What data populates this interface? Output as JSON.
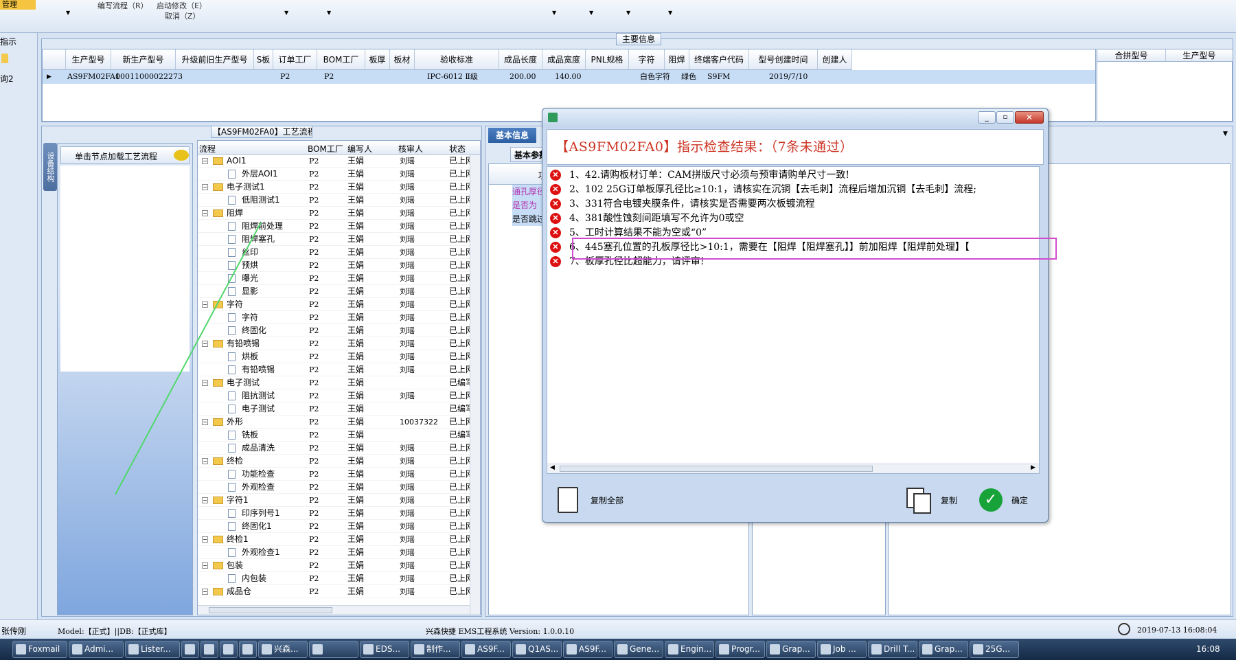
{
  "toolbar": {
    "items": [
      "编写流程（R）",
      "启动修改（E）",
      "取消（Z）"
    ],
    "left_title": "管理"
  },
  "leftnav": {
    "items": [
      "指示",
      "询2"
    ]
  },
  "main_info": {
    "title": "主要信息",
    "columns": [
      "生产型号",
      "新生产型号",
      "升级前旧生产型号",
      "S板",
      "订单工厂",
      "BOM工厂",
      "板厚",
      "板材",
      "验收标准",
      "成品长度",
      "成品宽度",
      "PNL规格",
      "字符",
      "阻焊",
      "终端客户代码",
      "型号创建时间",
      "创建人"
    ],
    "row": [
      "AS9FM02FA0",
      "10011000022273",
      "",
      "",
      "P2",
      "P2",
      "",
      "",
      "IPC-6012 Ⅱ级",
      "200.00",
      "140.00",
      "",
      "白色字符",
      "绿色",
      "S9FM",
      "2019/7/10",
      ""
    ],
    "side_columns": [
      "合拼型号",
      "生产型号"
    ]
  },
  "process": {
    "title": "【AS9FM02FA0】工艺流程",
    "side_tab": "设备结构",
    "hint": "单击节点加载工艺流程",
    "columns": [
      "流程",
      "BOM工厂",
      "编写人",
      "核审人",
      "状态"
    ],
    "rows": [
      {
        "name": "AOI1",
        "level": 1,
        "bom": "P2",
        "writer": "王娟",
        "reviewer": "刘瑶",
        "status": "已上网"
      },
      {
        "name": "外层AOI1",
        "level": 2,
        "bom": "P2",
        "writer": "王娟",
        "reviewer": "刘瑶",
        "status": "已上网"
      },
      {
        "name": "电子测试1",
        "level": 1,
        "bom": "P2",
        "writer": "王娟",
        "reviewer": "刘瑶",
        "status": "已上网"
      },
      {
        "name": "低阻测试1",
        "level": 2,
        "bom": "P2",
        "writer": "王娟",
        "reviewer": "刘瑶",
        "status": "已上网"
      },
      {
        "name": "阻焊",
        "level": 1,
        "bom": "P2",
        "writer": "王娟",
        "reviewer": "刘瑶",
        "status": "已上网"
      },
      {
        "name": "阻焊前处理",
        "level": 2,
        "bom": "P2",
        "writer": "王娟",
        "reviewer": "刘瑶",
        "status": "已上网"
      },
      {
        "name": "阻焊塞孔",
        "level": 2,
        "bom": "P2",
        "writer": "王娟",
        "reviewer": "刘瑶",
        "status": "已上网"
      },
      {
        "name": "丝印",
        "level": 2,
        "bom": "P2",
        "writer": "王娟",
        "reviewer": "刘瑶",
        "status": "已上网"
      },
      {
        "name": "预烘",
        "level": 2,
        "bom": "P2",
        "writer": "王娟",
        "reviewer": "刘瑶",
        "status": "已上网"
      },
      {
        "name": "曝光",
        "level": 2,
        "bom": "P2",
        "writer": "王娟",
        "reviewer": "刘瑶",
        "status": "已上网"
      },
      {
        "name": "显影",
        "level": 2,
        "bom": "P2",
        "writer": "王娟",
        "reviewer": "刘瑶",
        "status": "已上网"
      },
      {
        "name": "字符",
        "level": 1,
        "bom": "P2",
        "writer": "王娟",
        "reviewer": "刘瑶",
        "status": "已上网"
      },
      {
        "name": "字符",
        "level": 2,
        "bom": "P2",
        "writer": "王娟",
        "reviewer": "刘瑶",
        "status": "已上网"
      },
      {
        "name": "终固化",
        "level": 2,
        "bom": "P2",
        "writer": "王娟",
        "reviewer": "刘瑶",
        "status": "已上网"
      },
      {
        "name": "有铅喷锡",
        "level": 1,
        "bom": "P2",
        "writer": "王娟",
        "reviewer": "刘瑶",
        "status": "已上网"
      },
      {
        "name": "烘板",
        "level": 2,
        "bom": "P2",
        "writer": "王娟",
        "reviewer": "刘瑶",
        "status": "已上网"
      },
      {
        "name": "有铅喷锡",
        "level": 2,
        "bom": "P2",
        "writer": "王娟",
        "reviewer": "刘瑶",
        "status": "已上网"
      },
      {
        "name": "电子测试",
        "level": 1,
        "bom": "P2",
        "writer": "王娟",
        "reviewer": "",
        "status": "已编写"
      },
      {
        "name": "阻抗测试",
        "level": 2,
        "bom": "P2",
        "writer": "王娟",
        "reviewer": "刘瑶",
        "status": "已上网"
      },
      {
        "name": "电子测试",
        "level": 2,
        "bom": "P2",
        "writer": "王娟",
        "reviewer": "",
        "status": "已编写"
      },
      {
        "name": "外形",
        "level": 1,
        "bom": "P2",
        "writer": "王娟",
        "reviewer": "10037322",
        "status": "已上网"
      },
      {
        "name": "铣板",
        "level": 2,
        "bom": "P2",
        "writer": "王娟",
        "reviewer": "",
        "status": "已编写"
      },
      {
        "name": "成品清洗",
        "level": 2,
        "bom": "P2",
        "writer": "王娟",
        "reviewer": "刘瑶",
        "status": "已上网"
      },
      {
        "name": "终检",
        "level": 1,
        "bom": "P2",
        "writer": "王娟",
        "reviewer": "刘瑶",
        "status": "已上网"
      },
      {
        "name": "功能检查",
        "level": 2,
        "bom": "P2",
        "writer": "王娟",
        "reviewer": "刘瑶",
        "status": "已上网"
      },
      {
        "name": "外观检查",
        "level": 2,
        "bom": "P2",
        "writer": "王娟",
        "reviewer": "刘瑶",
        "status": "已上网"
      },
      {
        "name": "字符1",
        "level": 1,
        "bom": "P2",
        "writer": "王娟",
        "reviewer": "刘瑶",
        "status": "已上网"
      },
      {
        "name": "印序列号1",
        "level": 2,
        "bom": "P2",
        "writer": "王娟",
        "reviewer": "刘瑶",
        "status": "已上网"
      },
      {
        "name": "终固化1",
        "level": 2,
        "bom": "P2",
        "writer": "王娟",
        "reviewer": "刘瑶",
        "status": "已上网"
      },
      {
        "name": "终检1",
        "level": 1,
        "bom": "P2",
        "writer": "王娟",
        "reviewer": "刘瑶",
        "status": "已上网"
      },
      {
        "name": "外观检查1",
        "level": 2,
        "bom": "P2",
        "writer": "王娟",
        "reviewer": "刘瑶",
        "status": "已上网"
      },
      {
        "name": "包装",
        "level": 1,
        "bom": "P2",
        "writer": "王娟",
        "reviewer": "刘瑶",
        "status": "已上网"
      },
      {
        "name": "内包装",
        "level": 2,
        "bom": "P2",
        "writer": "王娟",
        "reviewer": "刘瑶",
        "status": "已上网"
      },
      {
        "name": "成品仓",
        "level": 1,
        "bom": "P2",
        "writer": "王娟",
        "reviewer": "刘瑶",
        "status": "已上网"
      }
    ]
  },
  "basic": {
    "tab": "基本信息",
    "sub_tab": "基本参数",
    "col": "项",
    "rows": [
      "通孔厚径",
      "是否为",
      "是否跳过"
    ]
  },
  "dialog": {
    "title": "【AS9FM02FA0】指示检查结果：（7条未通过）",
    "messages": [
      "1、42.请购板材订单：CAM拼版尺寸必须与预审请购单尺寸一致!",
      "2、102 25G订单板厚孔径比≥10:1，请核实在沉铜【去毛刺】流程后增加沉铜【去毛刺】流程;",
      "3、331符合电镀夹膜条件，请核实是否需要两次板镀流程",
      "4、381酸性蚀刻间距填写不允许为0或空",
      "5、工时计算结果不能为空或“0”",
      "6、445塞孔位置的孔板厚径比>10:1，需要在【阻焊【阻焊塞孔】】前加阻焊【阻焊前处理】【",
      "7、板厚孔径比超能力，请评审!"
    ],
    "copy_all": "复制全部",
    "copy": "复制",
    "ok": "确定"
  },
  "status": {
    "user": "张传刚",
    "model": "Model:【正式】||DB:【正式库】",
    "system": "兴森快捷 EMS工程系统 Version: 1.0.0.10",
    "datetime": "2019-07-13 16:08:04"
  },
  "taskbar": {
    "items": [
      "Foxmail",
      "Admi...",
      "Lister...",
      "",
      "",
      "",
      "",
      "兴森...",
      "",
      "EDS...",
      "制作...",
      "AS9F...",
      "Q1AS...",
      "AS9F...",
      "Gene...",
      "Engin...",
      "Progr...",
      "Grap...",
      "Job ...",
      "Drill T...",
      "Grap...",
      "25G..."
    ],
    "clock": "16:08"
  },
  "colors": {
    "accent": "#cc3322",
    "highlight": "#d04ccf",
    "selected_row": "#c7dcf5"
  }
}
